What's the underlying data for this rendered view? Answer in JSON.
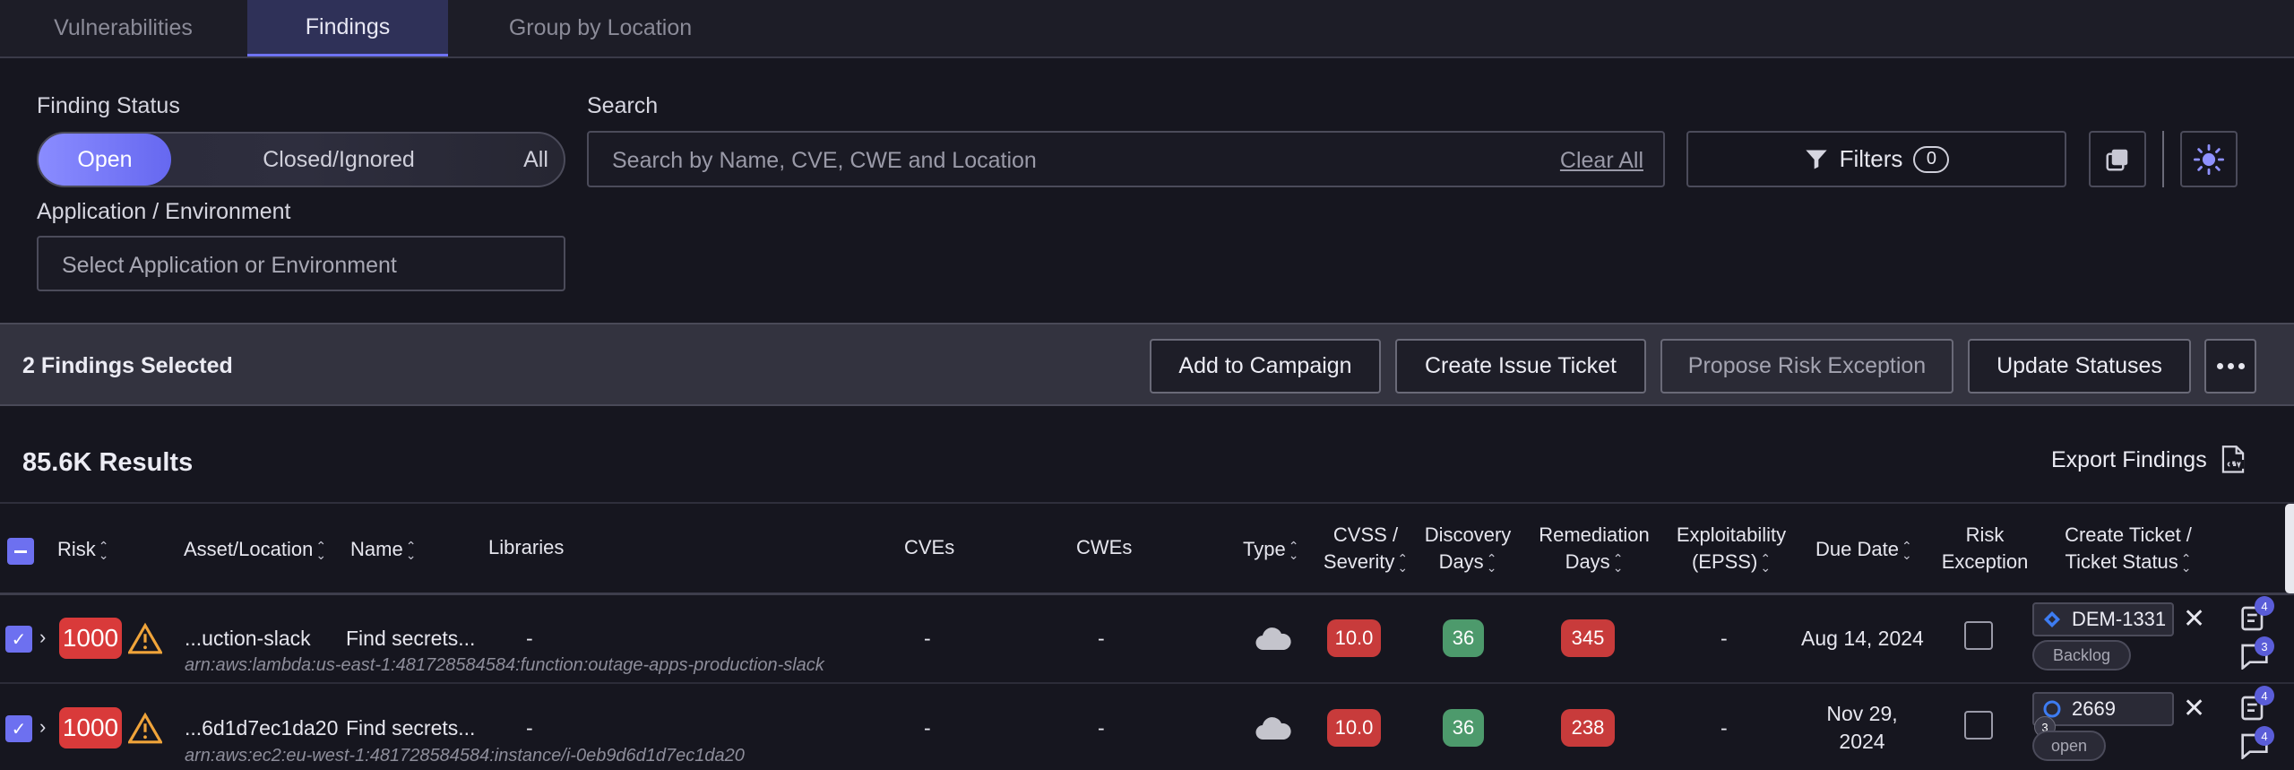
{
  "tabs": [
    {
      "label": "Vulnerabilities",
      "active": false
    },
    {
      "label": "Findings",
      "active": true
    },
    {
      "label": "Group by Location",
      "active": false
    }
  ],
  "filters": {
    "status_label": "Finding Status",
    "status_options": [
      "Open",
      "Closed/Ignored",
      "All"
    ],
    "status_selected": "Open",
    "search_label": "Search",
    "search_placeholder": "Search by Name, CVE, CWE and Location",
    "clear_all": "Clear All",
    "filters_label": "Filters",
    "filters_count": "0",
    "app_env_label": "Application / Environment",
    "app_env_placeholder": "Select Application or Environment"
  },
  "selection": {
    "text": "2 Findings Selected",
    "actions": [
      {
        "label": "Add to Campaign",
        "enabled": true
      },
      {
        "label": "Create Issue Ticket",
        "enabled": true
      },
      {
        "label": "Propose Risk Exception",
        "enabled": false
      },
      {
        "label": "Update Statuses",
        "enabled": true
      }
    ]
  },
  "results": {
    "count_text": "85.6K Results",
    "export_label": "Export Findings"
  },
  "table": {
    "headers": {
      "risk": "Risk",
      "asset": "Asset/Location",
      "name": "Name",
      "libraries": "Libraries",
      "cves": "CVEs",
      "cwes": "CWEs",
      "type": "Type",
      "cvss_1": "CVSS /",
      "cvss_2": "Severity",
      "disc_1": "Discovery",
      "disc_2": "Days",
      "rem_1": "Remediation",
      "rem_2": "Days",
      "exp_1": "Exploitability",
      "exp_2": "(EPSS)",
      "due": "Due Date",
      "riskex_1": "Risk",
      "riskex_2": "Exception",
      "ticket_1": "Create Ticket /",
      "ticket_2": "Ticket Status"
    },
    "rows": [
      {
        "risk": "1000",
        "asset": "...uction-slack",
        "arn": "arn:aws:lambda:us-east-1:481728584584:function:outage-apps-production-slack",
        "name": "Find secrets...",
        "libraries": "-",
        "cves": "-",
        "cwes": "-",
        "type_icon": "cloud-icon",
        "cvss": "10.0",
        "discovery_days": "36",
        "remediation_days": "345",
        "epss": "-",
        "due_date_1": "Aug 14, 2024",
        "due_date_2": "",
        "ticket_id": "DEM-1331",
        "ticket_status": "Backlog",
        "ticket_icon": "jira-icon",
        "badge_top": "4",
        "badge_bottom": "3",
        "avatar_count": ""
      },
      {
        "risk": "1000",
        "asset": "...6d1d7ec1da20",
        "arn": "arn:aws:ec2:eu-west-1:481728584584:instance/i-0eb9d6d1d7ec1da20",
        "name": "Find secrets...",
        "libraries": "-",
        "cves": "-",
        "cwes": "-",
        "type_icon": "cloud-icon",
        "cvss": "10.0",
        "discovery_days": "36",
        "remediation_days": "238",
        "epss": "-",
        "due_date_1": "Nov 29,",
        "due_date_2": "2024",
        "ticket_id": "2669",
        "ticket_status": "open",
        "ticket_icon": "github-icon",
        "badge_top": "4",
        "badge_bottom": "4",
        "avatar_count": "3"
      }
    ]
  },
  "colors": {
    "accent": "#6d70f0",
    "risk_red": "#d93a3a",
    "severity_red": "#c83b3b",
    "days_green": "#4d9a6c",
    "background": "#16161f"
  }
}
